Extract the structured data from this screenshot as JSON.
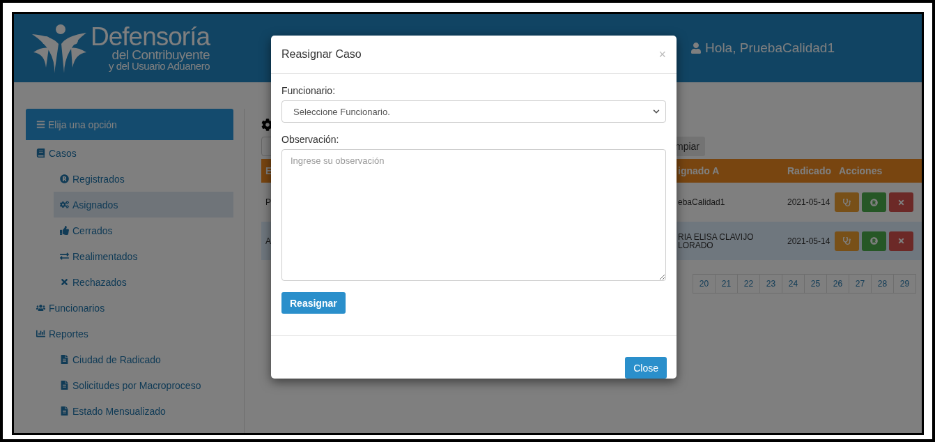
{
  "header": {
    "logo": {
      "line_1": "Defensoría",
      "line_2": "del Contribuyente",
      "line_3": "y del Usuario Aduanero"
    },
    "greeting": "Hola, PruebaCalidad1"
  },
  "sidebar": {
    "title": "Elija una opción",
    "items": [
      {
        "label": "Casos",
        "children": [
          {
            "label": "Registrados",
            "selected": false
          },
          {
            "label": "Asignados",
            "selected": true
          },
          {
            "label": "Cerrados",
            "selected": false
          },
          {
            "label": "Realimentados",
            "selected": false
          },
          {
            "label": "Rechazados",
            "selected": false
          }
        ]
      },
      {
        "label": "Funcionarios"
      },
      {
        "label": "Reportes",
        "children": [
          {
            "label": "Ciudad de Radicado",
            "selected": false
          },
          {
            "label": "Solicitudes por Macroproceso",
            "selected": false
          },
          {
            "label": "Estado Mensualizado",
            "selected": false
          }
        ]
      }
    ]
  },
  "content": {
    "filter_button": "mpiar",
    "table": {
      "columns": [
        "E",
        "ignado A",
        "Radicado",
        "Acciones"
      ],
      "rows": [
        {
          "column_1": "P",
          "assigned": [
            "ebaCalidad1"
          ],
          "date": "2021-05-14",
          "selected": false
        },
        {
          "column_1": "A",
          "assigned": [
            "RIA ELISA CLAVIJO",
            "LORADO"
          ],
          "date": "2021-05-14",
          "selected": true
        }
      ]
    },
    "pagination": {
      "pages": [
        "20",
        "21",
        "22",
        "23",
        "24",
        "25",
        "26",
        "27",
        "28",
        "29"
      ]
    }
  },
  "modal": {
    "title": "Reasignar Caso",
    "close_icon": "×",
    "fields": [
      {
        "kind": "select",
        "label": "Funcionario:",
        "value": "Seleccione Funcionario."
      },
      {
        "kind": "textarea",
        "label": "Observación:",
        "placeholder": "Ingrese su observación"
      }
    ],
    "submit": "Reasignar",
    "footer_button": "Close"
  }
}
